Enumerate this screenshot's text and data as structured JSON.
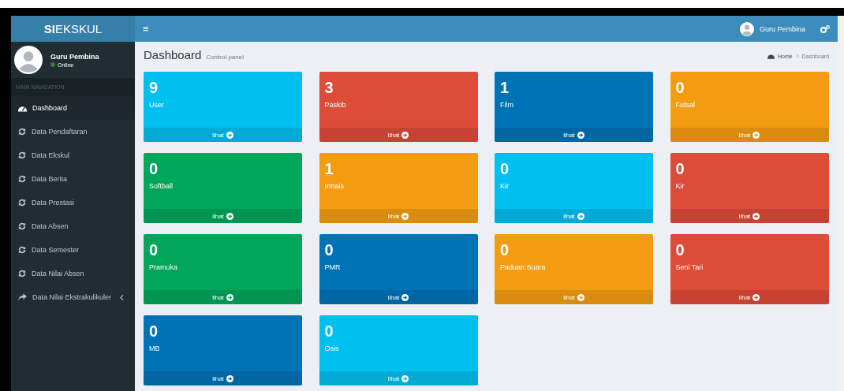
{
  "logo": {
    "bold": "SI",
    "rest": "EKSKUL"
  },
  "header": {
    "menu_glyph": "≡",
    "user_name": "Guru Pembina"
  },
  "sidebar": {
    "user_name": "Guru Pembina",
    "status": "Online",
    "section": "MAIN NAVIGATION",
    "items": [
      {
        "label": "Dashboard",
        "kind": "dashboard",
        "selected": true,
        "submenu": false
      },
      {
        "label": "Data Pendaftaran",
        "kind": "refresh",
        "selected": false,
        "submenu": false
      },
      {
        "label": "Data Ekskul",
        "kind": "refresh",
        "selected": false,
        "submenu": false
      },
      {
        "label": "Data Berita",
        "kind": "refresh",
        "selected": false,
        "submenu": false
      },
      {
        "label": "Data Prestasi",
        "kind": "refresh",
        "selected": false,
        "submenu": false
      },
      {
        "label": "Data Absen",
        "kind": "refresh",
        "selected": false,
        "submenu": false
      },
      {
        "label": "Data Semester",
        "kind": "refresh",
        "selected": false,
        "submenu": false
      },
      {
        "label": "Data Nilai Absen",
        "kind": "refresh",
        "selected": false,
        "submenu": false
      },
      {
        "label": "Data Nilai Ekstrakulikuler",
        "kind": "share",
        "selected": false,
        "submenu": true
      }
    ]
  },
  "page": {
    "title": "Dashboard",
    "subtitle": "Control panel",
    "breadcrumb": [
      "Home",
      "Dashboard"
    ]
  },
  "cards": [
    {
      "count": "9",
      "label": "User",
      "link": "lihat",
      "color": "#00c0ef"
    },
    {
      "count": "3",
      "label": "Paskib",
      "link": "lihat",
      "color": "#dd4b39"
    },
    {
      "count": "1",
      "label": "Film",
      "link": "lihat",
      "color": "#0073b7"
    },
    {
      "count": "0",
      "label": "Futsal",
      "link": "lihat",
      "color": "#f39c12"
    },
    {
      "count": "0",
      "label": "Softball",
      "link": "lihat",
      "color": "#00a65a"
    },
    {
      "count": "1",
      "label": "Irmais",
      "link": "lihat",
      "color": "#f39c12"
    },
    {
      "count": "0",
      "label": "Kir",
      "link": "lihat",
      "color": "#00c0ef"
    },
    {
      "count": "0",
      "label": "Kir",
      "link": "lihat",
      "color": "#dd4b39"
    },
    {
      "count": "0",
      "label": "Pramuka",
      "link": "lihat",
      "color": "#00a65a"
    },
    {
      "count": "0",
      "label": "PMR",
      "link": "lihat",
      "color": "#0073b7"
    },
    {
      "count": "0",
      "label": "Paduan Suara",
      "link": "lihat",
      "color": "#f39c12"
    },
    {
      "count": "0",
      "label": "Seni Tari",
      "link": "lihat",
      "color": "#dd4b39"
    },
    {
      "count": "0",
      "label": "MB",
      "link": "lihat",
      "color": "#0073b7"
    },
    {
      "count": "0",
      "label": "Osis",
      "link": "lihat",
      "color": "#00c0ef"
    }
  ]
}
